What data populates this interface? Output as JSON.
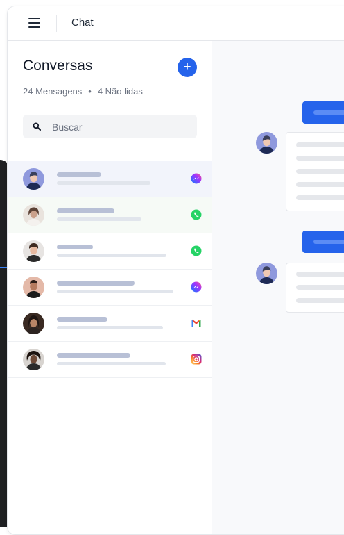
{
  "window": {
    "title": "Chat"
  },
  "sidebar": {
    "title": "Conversas",
    "stats": {
      "messages": "24 Mensagens",
      "separator": "•",
      "unread": "4 Não lidas"
    },
    "search": {
      "placeholder": "Buscar",
      "value": ""
    },
    "conversations": [
      {
        "channel": "messenger-icon",
        "active": true
      },
      {
        "channel": "whatsapp-icon",
        "highlighted": true
      },
      {
        "channel": "whatsapp-icon"
      },
      {
        "channel": "messenger-icon"
      },
      {
        "channel": "gmail-icon"
      },
      {
        "channel": "instagram-icon"
      }
    ]
  },
  "colors": {
    "accent": "#2563eb",
    "whatsapp": "#25d366",
    "messenger": "#7b4dff",
    "instagram": "#e1306c"
  }
}
